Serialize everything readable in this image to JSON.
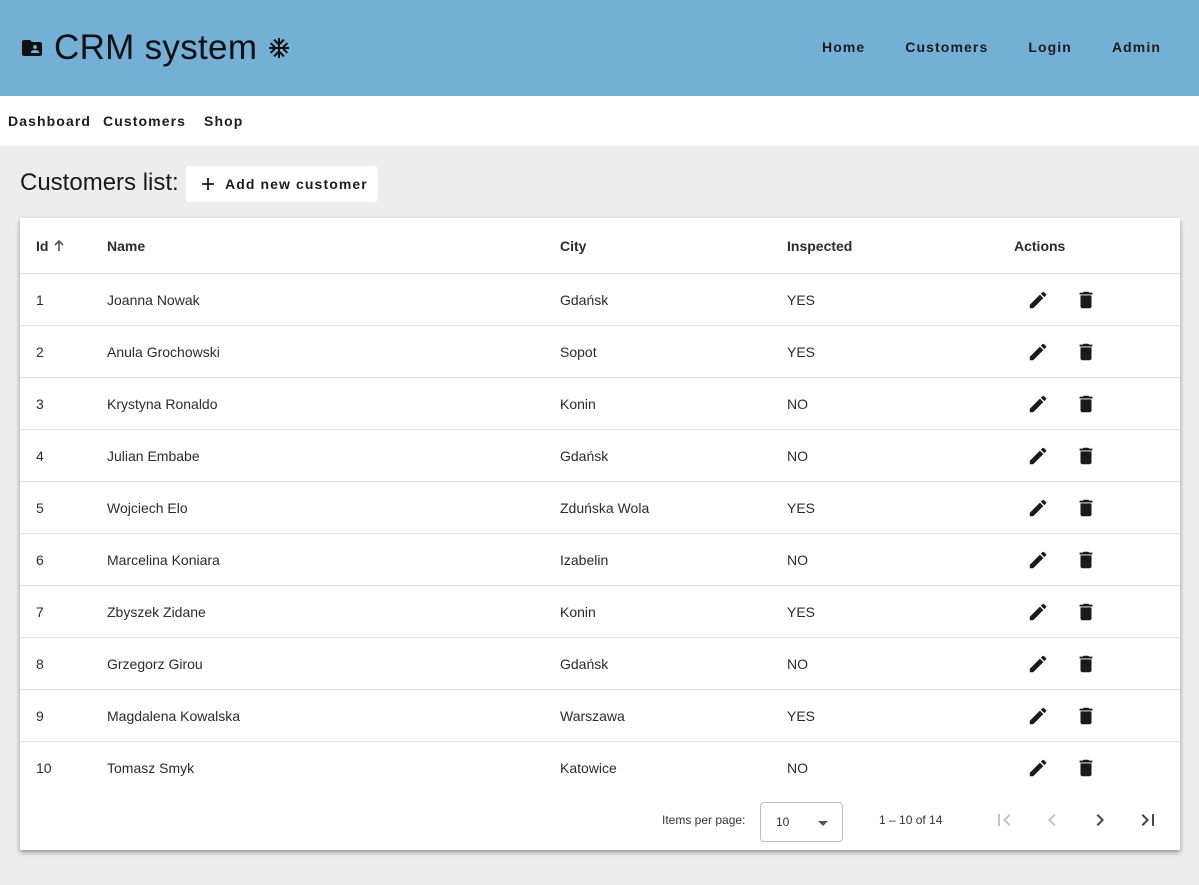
{
  "header": {
    "title": "CRM system",
    "logo_icon": "contact-folder-icon",
    "decor_icon": "snowflake-icon",
    "nav": [
      "Home",
      "Customers",
      "Login",
      "Admin"
    ],
    "background": "#74afd6"
  },
  "subnav": {
    "items": [
      "Dashboard",
      "Customers",
      "Shop"
    ]
  },
  "page": {
    "heading": "Customers list:",
    "add_button": "Add new customer",
    "add_icon": "plus-icon"
  },
  "table": {
    "columns": [
      "Id",
      "Name",
      "City",
      "Inspected",
      "Actions"
    ],
    "sort": {
      "column": "Id",
      "direction": "ascending",
      "icon": "arrow-up-icon"
    },
    "action_icons": [
      "edit-icon",
      "delete-icon"
    ],
    "rows": [
      {
        "id": "1",
        "name": "Joanna Nowak",
        "city": "Gdańsk",
        "inspected": "YES"
      },
      {
        "id": "2",
        "name": "Anula Grochowski",
        "city": "Sopot",
        "inspected": "YES"
      },
      {
        "id": "3",
        "name": "Krystyna Ronaldo",
        "city": "Konin",
        "inspected": "NO"
      },
      {
        "id": "4",
        "name": "Julian Embabe",
        "city": "Gdańsk",
        "inspected": "NO"
      },
      {
        "id": "5",
        "name": "Wojciech Elo",
        "city": "Zduńska Wola",
        "inspected": "YES"
      },
      {
        "id": "6",
        "name": "Marcelina Koniara",
        "city": "Izabelin",
        "inspected": "NO"
      },
      {
        "id": "7",
        "name": "Zbyszek Zidane",
        "city": "Konin",
        "inspected": "YES"
      },
      {
        "id": "8",
        "name": "Grzegorz Girou",
        "city": "Gdańsk",
        "inspected": "NO"
      },
      {
        "id": "9",
        "name": "Magdalena Kowalska",
        "city": "Warszawa",
        "inspected": "YES"
      },
      {
        "id": "10",
        "name": "Tomasz Smyk",
        "city": "Katowice",
        "inspected": "NO"
      }
    ]
  },
  "paginator": {
    "items_per_page_label": "Items per page:",
    "page_size": "10",
    "range_label": "1 – 10 of 14",
    "icons": [
      "first-page-icon",
      "previous-page-icon",
      "next-page-icon",
      "last-page-icon"
    ]
  }
}
